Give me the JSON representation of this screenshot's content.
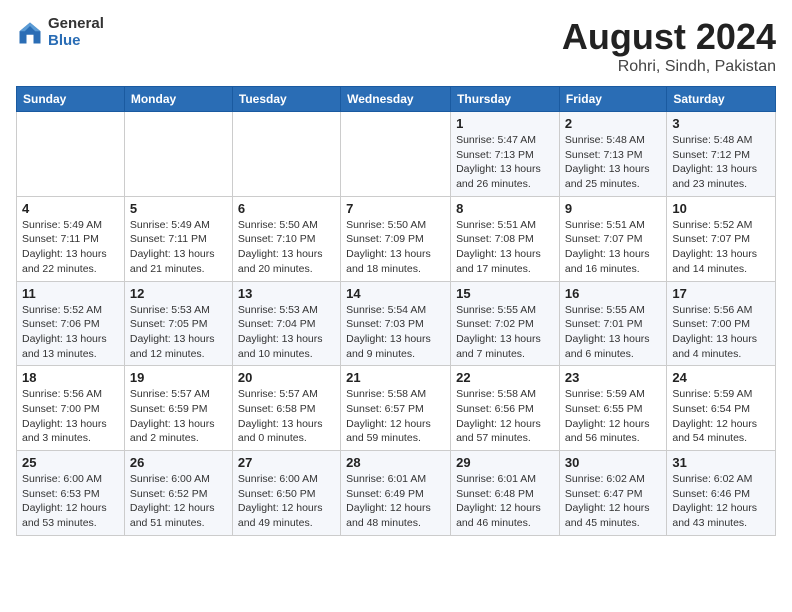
{
  "logo": {
    "general": "General",
    "blue": "Blue"
  },
  "title": {
    "month_year": "August 2024",
    "location": "Rohri, Sindh, Pakistan"
  },
  "days_of_week": [
    "Sunday",
    "Monday",
    "Tuesday",
    "Wednesday",
    "Thursday",
    "Friday",
    "Saturday"
  ],
  "weeks": [
    [
      {
        "day": "",
        "info": ""
      },
      {
        "day": "",
        "info": ""
      },
      {
        "day": "",
        "info": ""
      },
      {
        "day": "",
        "info": ""
      },
      {
        "day": "1",
        "info": "Sunrise: 5:47 AM\nSunset: 7:13 PM\nDaylight: 13 hours\nand 26 minutes."
      },
      {
        "day": "2",
        "info": "Sunrise: 5:48 AM\nSunset: 7:13 PM\nDaylight: 13 hours\nand 25 minutes."
      },
      {
        "day": "3",
        "info": "Sunrise: 5:48 AM\nSunset: 7:12 PM\nDaylight: 13 hours\nand 23 minutes."
      }
    ],
    [
      {
        "day": "4",
        "info": "Sunrise: 5:49 AM\nSunset: 7:11 PM\nDaylight: 13 hours\nand 22 minutes."
      },
      {
        "day": "5",
        "info": "Sunrise: 5:49 AM\nSunset: 7:11 PM\nDaylight: 13 hours\nand 21 minutes."
      },
      {
        "day": "6",
        "info": "Sunrise: 5:50 AM\nSunset: 7:10 PM\nDaylight: 13 hours\nand 20 minutes."
      },
      {
        "day": "7",
        "info": "Sunrise: 5:50 AM\nSunset: 7:09 PM\nDaylight: 13 hours\nand 18 minutes."
      },
      {
        "day": "8",
        "info": "Sunrise: 5:51 AM\nSunset: 7:08 PM\nDaylight: 13 hours\nand 17 minutes."
      },
      {
        "day": "9",
        "info": "Sunrise: 5:51 AM\nSunset: 7:07 PM\nDaylight: 13 hours\nand 16 minutes."
      },
      {
        "day": "10",
        "info": "Sunrise: 5:52 AM\nSunset: 7:07 PM\nDaylight: 13 hours\nand 14 minutes."
      }
    ],
    [
      {
        "day": "11",
        "info": "Sunrise: 5:52 AM\nSunset: 7:06 PM\nDaylight: 13 hours\nand 13 minutes."
      },
      {
        "day": "12",
        "info": "Sunrise: 5:53 AM\nSunset: 7:05 PM\nDaylight: 13 hours\nand 12 minutes."
      },
      {
        "day": "13",
        "info": "Sunrise: 5:53 AM\nSunset: 7:04 PM\nDaylight: 13 hours\nand 10 minutes."
      },
      {
        "day": "14",
        "info": "Sunrise: 5:54 AM\nSunset: 7:03 PM\nDaylight: 13 hours\nand 9 minutes."
      },
      {
        "day": "15",
        "info": "Sunrise: 5:55 AM\nSunset: 7:02 PM\nDaylight: 13 hours\nand 7 minutes."
      },
      {
        "day": "16",
        "info": "Sunrise: 5:55 AM\nSunset: 7:01 PM\nDaylight: 13 hours\nand 6 minutes."
      },
      {
        "day": "17",
        "info": "Sunrise: 5:56 AM\nSunset: 7:00 PM\nDaylight: 13 hours\nand 4 minutes."
      }
    ],
    [
      {
        "day": "18",
        "info": "Sunrise: 5:56 AM\nSunset: 7:00 PM\nDaylight: 13 hours\nand 3 minutes."
      },
      {
        "day": "19",
        "info": "Sunrise: 5:57 AM\nSunset: 6:59 PM\nDaylight: 13 hours\nand 2 minutes."
      },
      {
        "day": "20",
        "info": "Sunrise: 5:57 AM\nSunset: 6:58 PM\nDaylight: 13 hours\nand 0 minutes."
      },
      {
        "day": "21",
        "info": "Sunrise: 5:58 AM\nSunset: 6:57 PM\nDaylight: 12 hours\nand 59 minutes."
      },
      {
        "day": "22",
        "info": "Sunrise: 5:58 AM\nSunset: 6:56 PM\nDaylight: 12 hours\nand 57 minutes."
      },
      {
        "day": "23",
        "info": "Sunrise: 5:59 AM\nSunset: 6:55 PM\nDaylight: 12 hours\nand 56 minutes."
      },
      {
        "day": "24",
        "info": "Sunrise: 5:59 AM\nSunset: 6:54 PM\nDaylight: 12 hours\nand 54 minutes."
      }
    ],
    [
      {
        "day": "25",
        "info": "Sunrise: 6:00 AM\nSunset: 6:53 PM\nDaylight: 12 hours\nand 53 minutes."
      },
      {
        "day": "26",
        "info": "Sunrise: 6:00 AM\nSunset: 6:52 PM\nDaylight: 12 hours\nand 51 minutes."
      },
      {
        "day": "27",
        "info": "Sunrise: 6:00 AM\nSunset: 6:50 PM\nDaylight: 12 hours\nand 49 minutes."
      },
      {
        "day": "28",
        "info": "Sunrise: 6:01 AM\nSunset: 6:49 PM\nDaylight: 12 hours\nand 48 minutes."
      },
      {
        "day": "29",
        "info": "Sunrise: 6:01 AM\nSunset: 6:48 PM\nDaylight: 12 hours\nand 46 minutes."
      },
      {
        "day": "30",
        "info": "Sunrise: 6:02 AM\nSunset: 6:47 PM\nDaylight: 12 hours\nand 45 minutes."
      },
      {
        "day": "31",
        "info": "Sunrise: 6:02 AM\nSunset: 6:46 PM\nDaylight: 12 hours\nand 43 minutes."
      }
    ]
  ]
}
